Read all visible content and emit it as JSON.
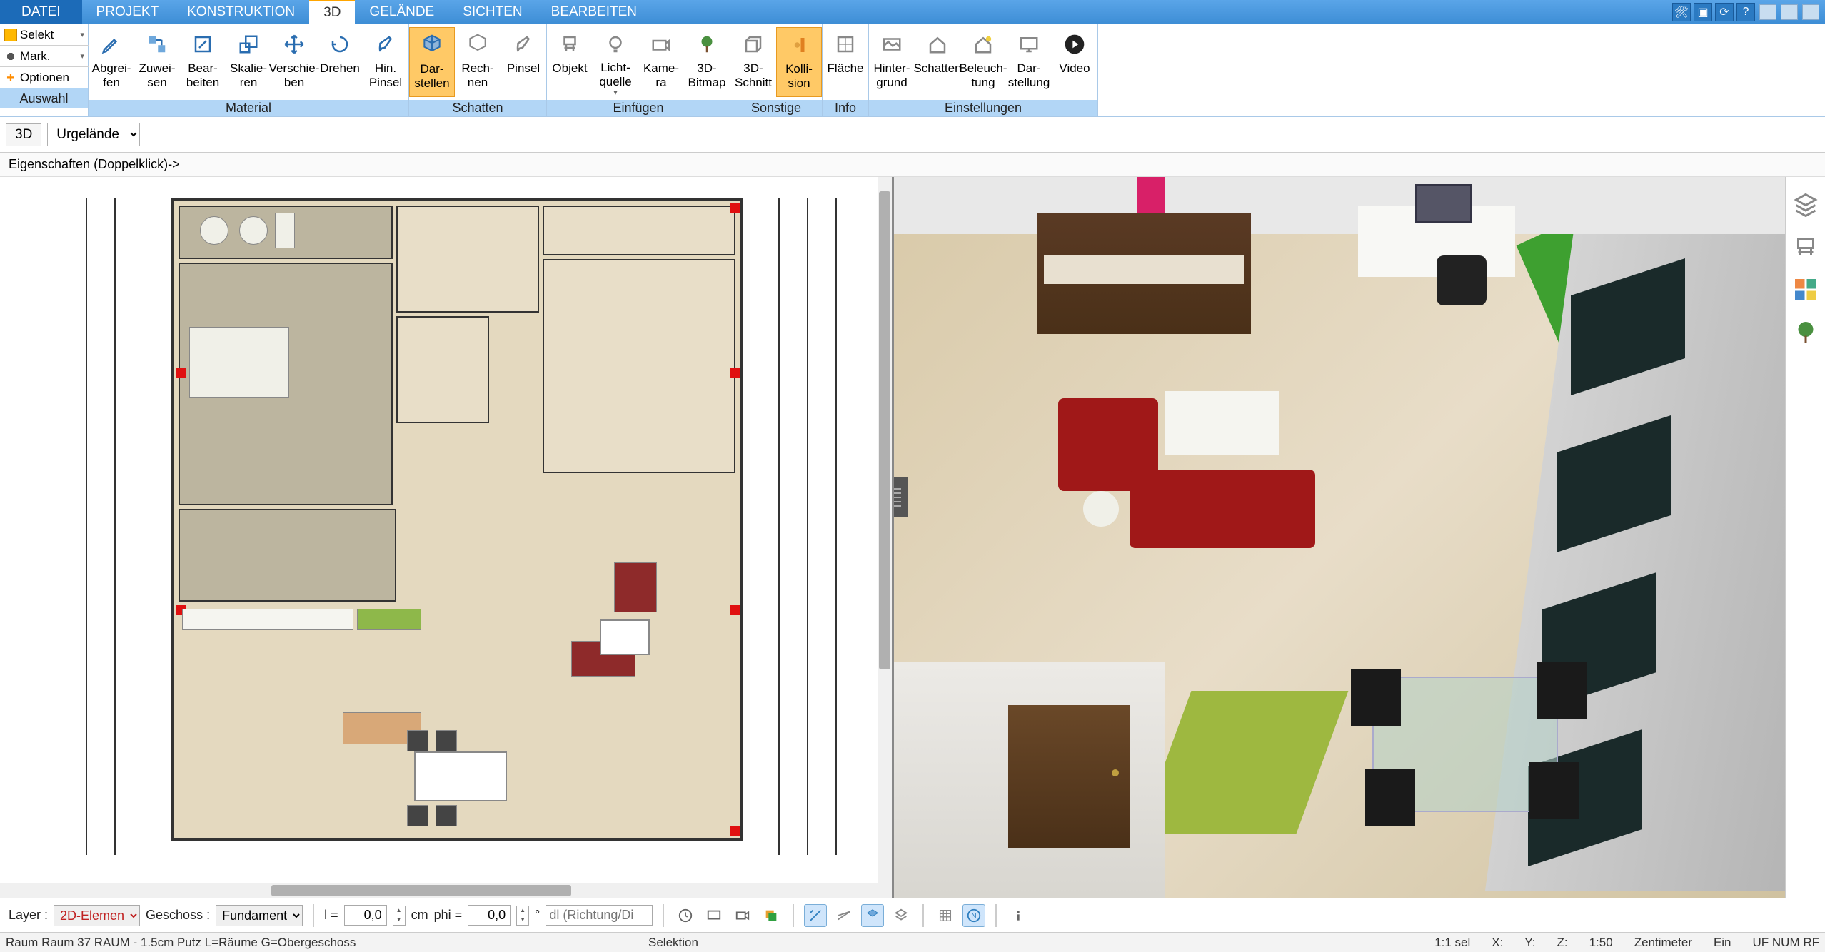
{
  "menubar": {
    "items": [
      "DATEI",
      "PROJEKT",
      "KONSTRUKTION",
      "3D",
      "GELÄNDE",
      "SICHTEN",
      "BEARBEITEN"
    ],
    "active_index": 3
  },
  "ribbon_left": {
    "select": "Selekt",
    "mark": "Mark.",
    "optionen": "Optionen"
  },
  "ribbon_groups": [
    {
      "label": "Auswahl",
      "side": true
    },
    {
      "label": "Material",
      "items": [
        {
          "lbl": "Abgrei-\nfen",
          "icon": "eyedropper"
        },
        {
          "lbl": "Zuwei-\nsen",
          "icon": "assign"
        },
        {
          "lbl": "Bear-\nbeiten",
          "icon": "edit"
        },
        {
          "lbl": "Skalie-\nren",
          "icon": "scale"
        },
        {
          "lbl": "Verschie-\nben",
          "icon": "move"
        },
        {
          "lbl": "Drehen",
          "icon": "rotate"
        },
        {
          "lbl": "Hin.\nPinsel",
          "icon": "brush"
        }
      ]
    },
    {
      "label": "Schatten",
      "items": [
        {
          "lbl": "Dar-\nstellen",
          "icon": "cube",
          "active": true
        },
        {
          "lbl": "Rech-\nnen",
          "icon": "cube2"
        },
        {
          "lbl": "Pinsel",
          "icon": "shadowbrush"
        }
      ]
    },
    {
      "label": "Einfügen",
      "items": [
        {
          "lbl": "Objekt",
          "icon": "chair"
        },
        {
          "lbl": "Licht-\nquelle",
          "icon": "bulb",
          "drop": true
        },
        {
          "lbl": "Kame-\nra",
          "icon": "camera"
        },
        {
          "lbl": "3D-\nBitmap",
          "icon": "tree"
        }
      ]
    },
    {
      "label": "Sonstige",
      "items": [
        {
          "lbl": "3D-\nSchnitt",
          "icon": "section"
        },
        {
          "lbl": "Kolli-\nsion",
          "icon": "collision",
          "active": true
        }
      ]
    },
    {
      "label": "Info",
      "items": [
        {
          "lbl": "Fläche",
          "icon": "area"
        }
      ]
    },
    {
      "label": "Einstellungen",
      "items": [
        {
          "lbl": "Hinter-\ngrund",
          "icon": "bg"
        },
        {
          "lbl": "Schatten",
          "icon": "shadow2"
        },
        {
          "lbl": "Beleuch-\ntung",
          "icon": "light2"
        },
        {
          "lbl": "Dar-\nstellung",
          "icon": "display"
        },
        {
          "lbl": "Video",
          "icon": "video"
        }
      ]
    }
  ],
  "sub_toolbar": {
    "btn_3d": "3D",
    "select_val": "Urgelände"
  },
  "props_row": "Eigenschaften (Doppelklick)->",
  "bottom": {
    "layer_label": "Layer :",
    "layer_val": "2D-Elemen",
    "geschoss_label": "Geschoss :",
    "geschoss_val": "Fundament",
    "l_label": "l =",
    "l_val": "0,0",
    "l_unit": "cm",
    "phi_label": "phi =",
    "phi_val": "0,0",
    "phi_unit": "°",
    "dir_placeholder": "dl (Richtung/Di"
  },
  "statusbar": {
    "left": "Raum Raum 37 RAUM - 1.5cm Putz L=Räume G=Obergeschoss",
    "selektion": "Selektion",
    "sel_ratio": "1:1 sel",
    "x": "X:",
    "y": "Y:",
    "z": "Z:",
    "scale": "1:50",
    "unit": "Zentimeter",
    "ein": "Ein",
    "flags": "UF NUM RF"
  },
  "right_tools": [
    "layers",
    "chair3d",
    "colorgrid",
    "tree3d"
  ]
}
